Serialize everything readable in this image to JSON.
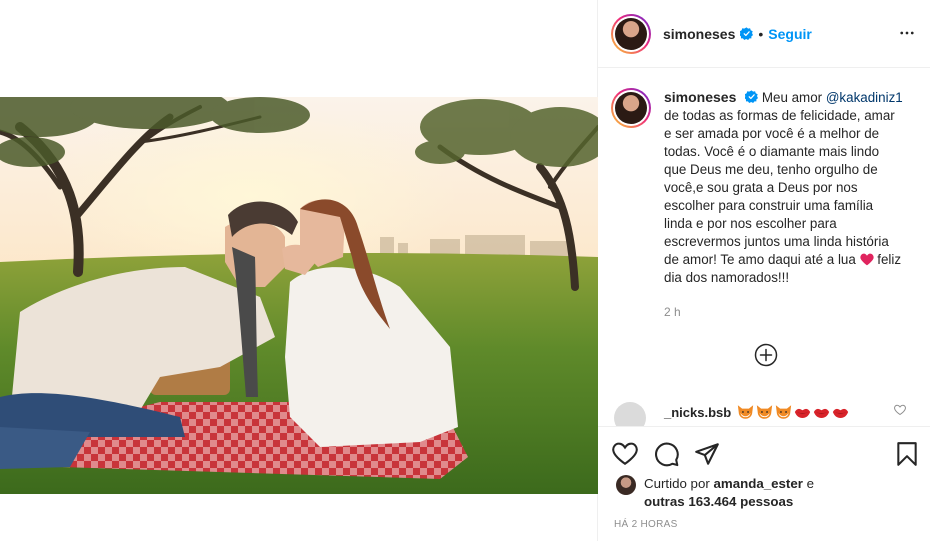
{
  "post": {
    "username": "simoneses",
    "follow_label": "Seguir",
    "separator": "•",
    "caption": {
      "mention": "@kakadiniz1",
      "text_before": "Meu amor ",
      "text_after": " de todas as formas de felicidade, amar e ser amada por você é a melhor de todas. Você é o diamante mais lindo que Deus me deu, tenho orgulho de você,e sou grata a Deus por nos escolher para construir uma família linda e por nos escolher para escrevermos juntos uma linda história de amor! Te amo daqui até a lua ",
      "text_end": " feliz dia dos namorados!!!",
      "time": "2 h"
    },
    "comment": {
      "username": "_nicks.bsb",
      "emojis": [
        "fox",
        "fox",
        "fox",
        "lips",
        "lips",
        "lips"
      ]
    },
    "likes": {
      "prefix": "Curtido por ",
      "liker": "amanda_ester",
      "mid": " e",
      "others": "outras 163.464 pessoas"
    },
    "timestamp": "HÁ 2 HORAS"
  },
  "icons": {
    "verified": "verified-badge-icon",
    "more": "more-options-icon",
    "load_more": "plus-circle-icon",
    "like": "heart-outline-icon",
    "comment": "comment-icon",
    "share": "send-icon",
    "save": "bookmark-icon"
  },
  "colors": {
    "link_blue": "#0095f6",
    "mention": "#00376b",
    "text": "#262626",
    "muted": "#8e8e8e"
  }
}
